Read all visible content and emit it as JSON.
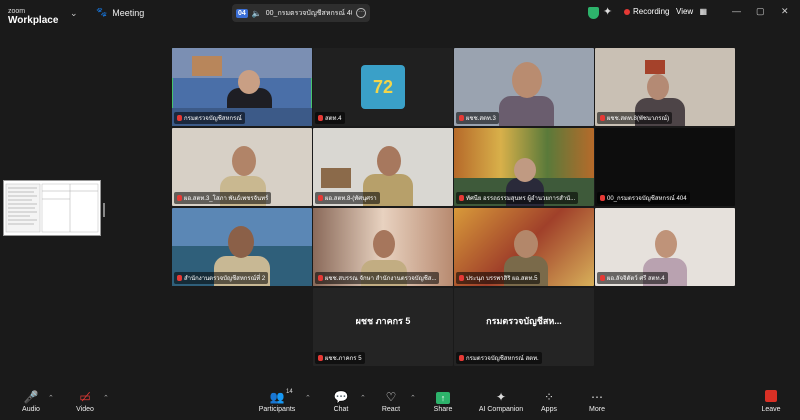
{
  "app": {
    "brand_top": "zoom",
    "brand_bottom": "Workplace"
  },
  "topbar": {
    "meeting_label": "Meeting",
    "share_number": "04",
    "share_title": "00_กรมตรวจบัญชีสหกรณ์ 404's",
    "recording_label": "Recording",
    "view_label": "View"
  },
  "tiles": [
    {
      "label": "กรมตรวจบัญชีสหกรณ์"
    },
    {
      "label": "สตท.4"
    },
    {
      "label": "ผชช.สตท.3"
    },
    {
      "label": "ผชช.สตท.8(พัชนาภรณ์)"
    },
    {
      "label": "ผอ.สตท.3_โสภา พันธ์เพชรจันทร์"
    },
    {
      "label": "ผอ.สตท.8-(ทัศนุศรา"
    },
    {
      "label": "ทัศนีย อรรถธรรมสุนทร ผู้อำนวยการสำนั..."
    },
    {
      "label": "00_กรมตรวจบัญชีสหกรณ์ 404"
    },
    {
      "label": "สำนักงานตรวจบัญชีสหกรณ์ที่ 2"
    },
    {
      "label": "ผชช.สบรรณ จักษา สำนักงานตรวจบัญชีส..."
    },
    {
      "label": "ประนุภ บรรพาสิริ ผอ.สตท.5"
    },
    {
      "label": "ผอ.ลัจจิตัตว์ ศรี สตท.4"
    },
    {
      "label": "ผชช.ภาคกร 5",
      "big": "ผชช ภาคกร 5"
    },
    {
      "label": "กรมตรวจบัญชีสหกรณ์ สตท.",
      "big": "กรมตรวจบัญชีสห..."
    }
  ],
  "bottombar": {
    "audio": "Audio",
    "video": "Video",
    "participants": "Participants",
    "participants_count": "14",
    "chat": "Chat",
    "react": "React",
    "share": "Share",
    "ai_companion": "AI Companion",
    "apps": "Apps",
    "more": "More",
    "leave": "Leave"
  },
  "colors": {
    "accent_green": "#2db36b",
    "record_red": "#e53935",
    "active_outline": "#46c46e"
  }
}
